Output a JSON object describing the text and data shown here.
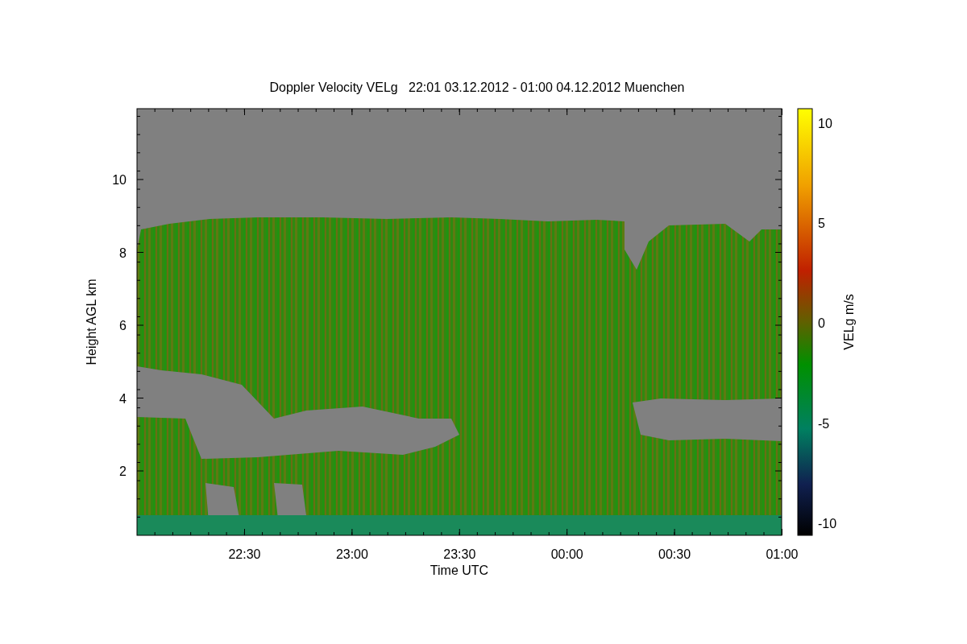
{
  "title": "Doppler Velocity VELg   22:01 03.12.2012 - 01:00 04.12.2012 Muenchen",
  "ylabel": "Height AGL km",
  "xlabel": "Time UTC",
  "yticks": [
    "10",
    "8",
    "6",
    "4",
    "2"
  ],
  "xticks": [
    "22:30",
    "23:00",
    "23:30",
    "00:00",
    "00:30",
    "01:00"
  ],
  "colorbar": {
    "label": "VELg m/s",
    "ticks": [
      "10",
      "5",
      "0",
      "-5",
      "-10"
    ]
  }
}
